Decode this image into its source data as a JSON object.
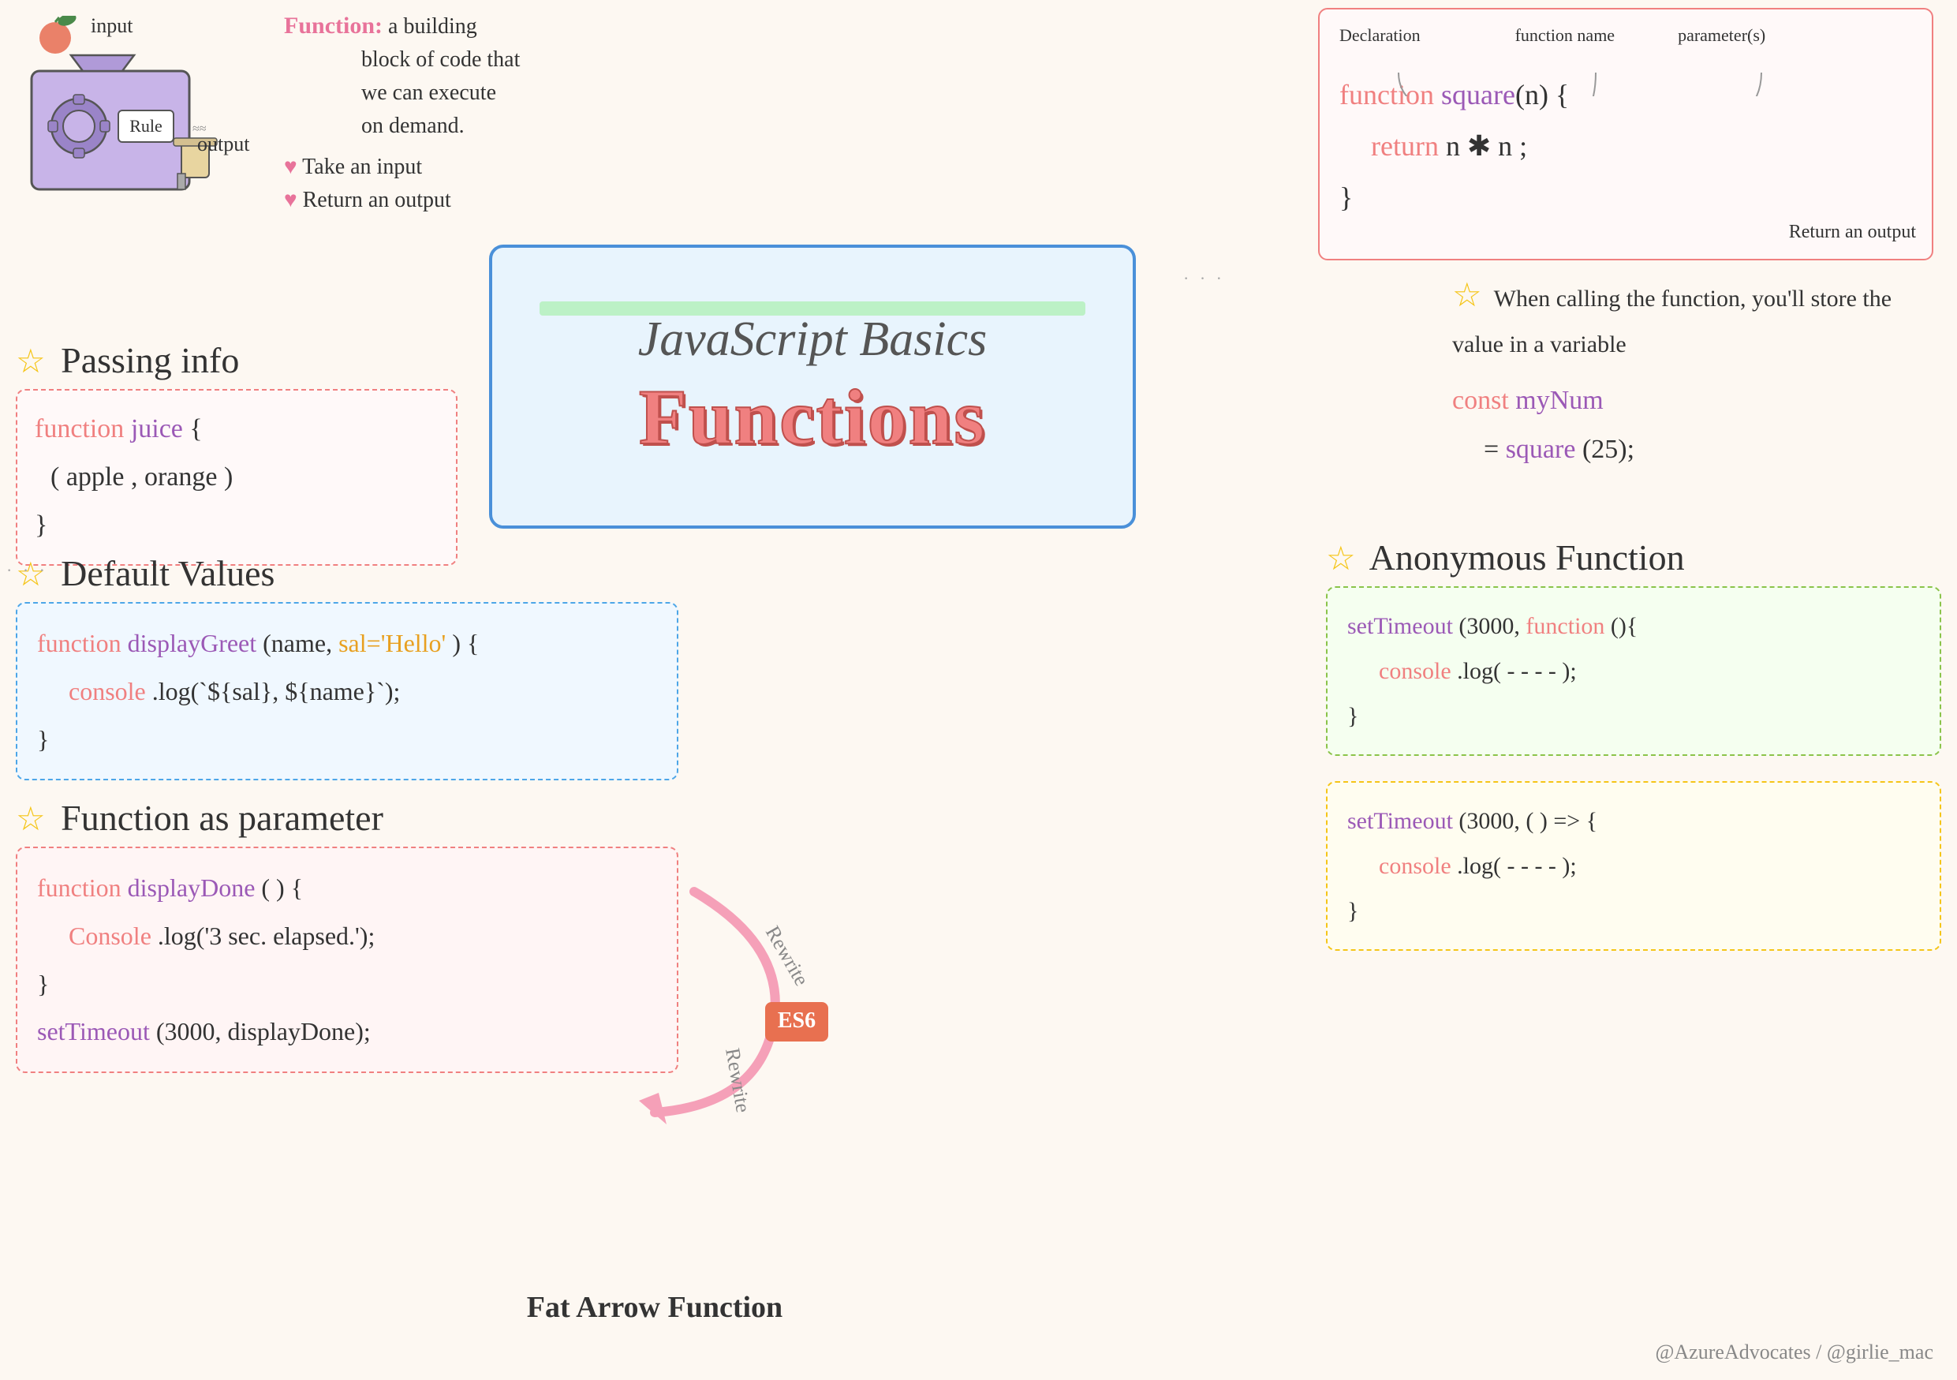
{
  "page": {
    "background": "#fdf8f2",
    "title": "JavaScript Basics Functions"
  },
  "machine": {
    "input_label": "input",
    "output_label": "output",
    "rule_label": "Rule",
    "gear": "⚙"
  },
  "function_def": {
    "title": "Function:",
    "description": "a building block of code that we can execute on demand.",
    "bullet1": "♥ Take an input",
    "bullet2": "♥ Return an output"
  },
  "declaration_box": {
    "label_declaration": "Declaration",
    "label_function_name": "function name",
    "label_parameters": "parameter(s)",
    "label_return_output": "Return an output",
    "code_line1": "function square(n) {",
    "code_line2": "  return n * n;",
    "code_line3": "}"
  },
  "title_box": {
    "subtitle": "JavaScript Basics",
    "title": "Functions"
  },
  "passing_info": {
    "section_title": "Passing info",
    "star": "☆",
    "code_line1": "function juice {",
    "code_line2": "( apple, orange )",
    "code_line3": "}"
  },
  "default_values": {
    "section_title": "Default Values",
    "star": "☆",
    "code_line1": "function displayGreet (name, sal='Hello') {",
    "code_line2": "  console.log(`${sal}, ${name}`);",
    "code_line3": "}"
  },
  "func_as_param": {
    "section_title": "Function as parameter",
    "star": "☆",
    "code_line1": "function displayDone( ) {",
    "code_line2": "  Console.log('3 sec. elapsed.');",
    "code_line3": "}",
    "code_line4": "setTimeout(3000, displayDone);"
  },
  "when_calling": {
    "star": "☆",
    "text": "When calling the function, you'll store the value in a variable",
    "code_line1": "const myNum",
    "code_line2": "= square(25);"
  },
  "anon_func": {
    "section_title": "Anonymous Function",
    "star": "☆",
    "code_line1": "setTimeout(3000, function(){",
    "code_line2": "  console.log( - - - - );",
    "code_line3": "}"
  },
  "fat_arrow": {
    "label": "Fat Arrow Function",
    "rewrite_label1": "Rewrite",
    "rewrite_label2": "Rewrite",
    "es6_badge": "ES6",
    "code_line1": "setTimeout (3000, () => {",
    "code_line2": "  console.log( - - - - );",
    "code_line3": "}"
  },
  "attribution": {
    "text": "@AzureAdvocates / @girlie_mac"
  }
}
